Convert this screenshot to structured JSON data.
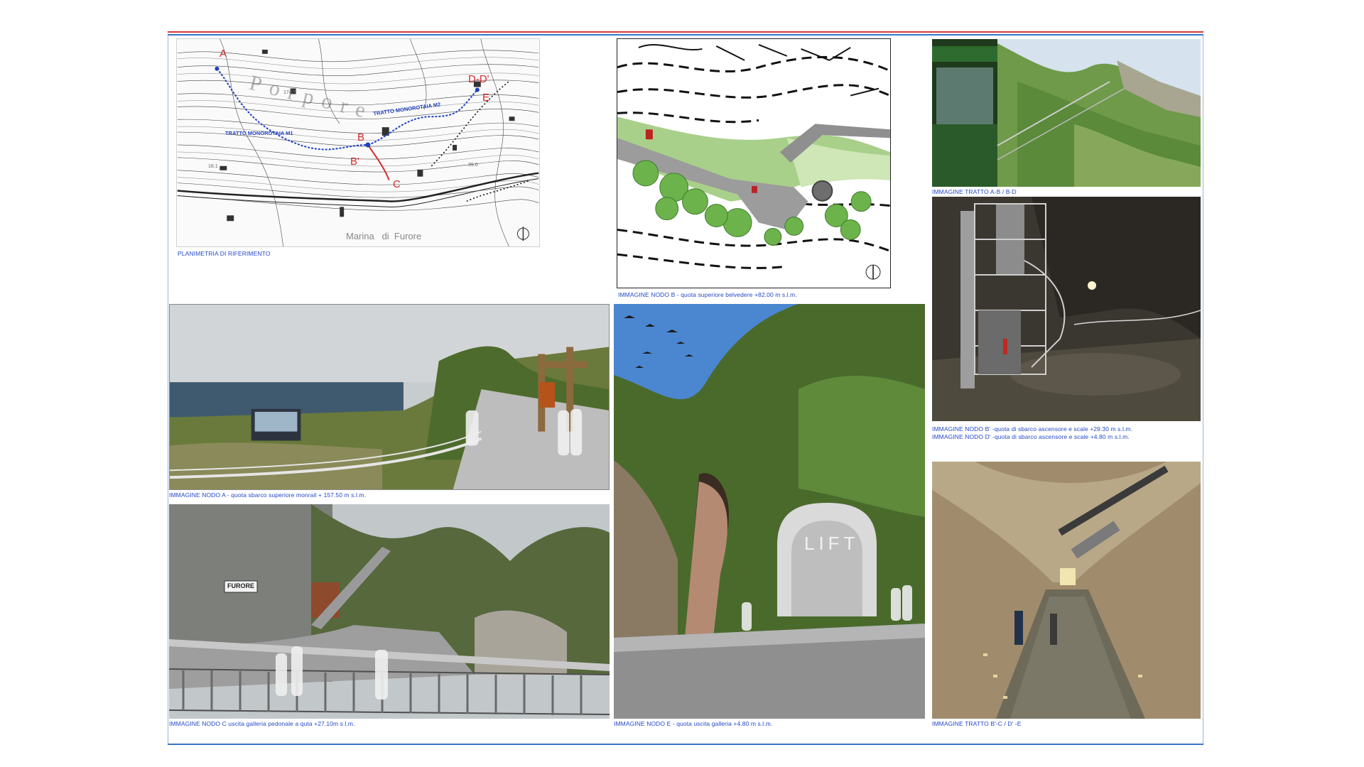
{
  "map": {
    "point_labels": [
      "A",
      "B",
      "B'",
      "C",
      "D-D'",
      "E"
    ],
    "route_m1": "TRATTO MONOROTAIA M1",
    "route_m2": "TRATTO MONOROTAIA M2",
    "place_big": "Porpore",
    "place_bottom": "Marina   di  Furore",
    "contour_numbers": [
      "174.7",
      "18.1",
      "39.6"
    ],
    "caption": "PLANIMETRIA DI RIFERIMENTO"
  },
  "captions": {
    "nodo_b": "IMMAGINE NODO B - quota superiore belvedere +82.00 m s.l.m.",
    "tratto_ab": "IMMAGINE TRATTO A-B / B-D",
    "nodo_b1_line1": "IMMAGINE NODO B' -quota di sbarco ascensore e scale +29.30 m s.l.m.",
    "nodo_b1_line2": "IMMAGINE NODO D' -quota di sbarco ascensore e scale +4.80 m s.l.m.",
    "nodo_a": "IMMAGINE NODO A - quota  sbarco superiore monrail  + 157.50 m s.l.m.",
    "nodo_c": "IMMAGINE NODO C  uscita galleria pedonale a quta +27.10m  s.l.m.",
    "nodo_e": "IMMAGINE NODO E - quota uscita galleria +4.80 m s.l.m.",
    "tratto_bc": "IMMAGINE TRATTO B'-C / D' -E"
  },
  "photo_text": {
    "lift_sign": "LIFT",
    "furore_sign": "FURORE"
  },
  "colors": {
    "caption_blue": "#2448c8",
    "route_blue": "#1f3fbf",
    "route_red": "#d42a2a",
    "frame_red": "#d9383a",
    "frame_blue": "#3b73c8"
  }
}
